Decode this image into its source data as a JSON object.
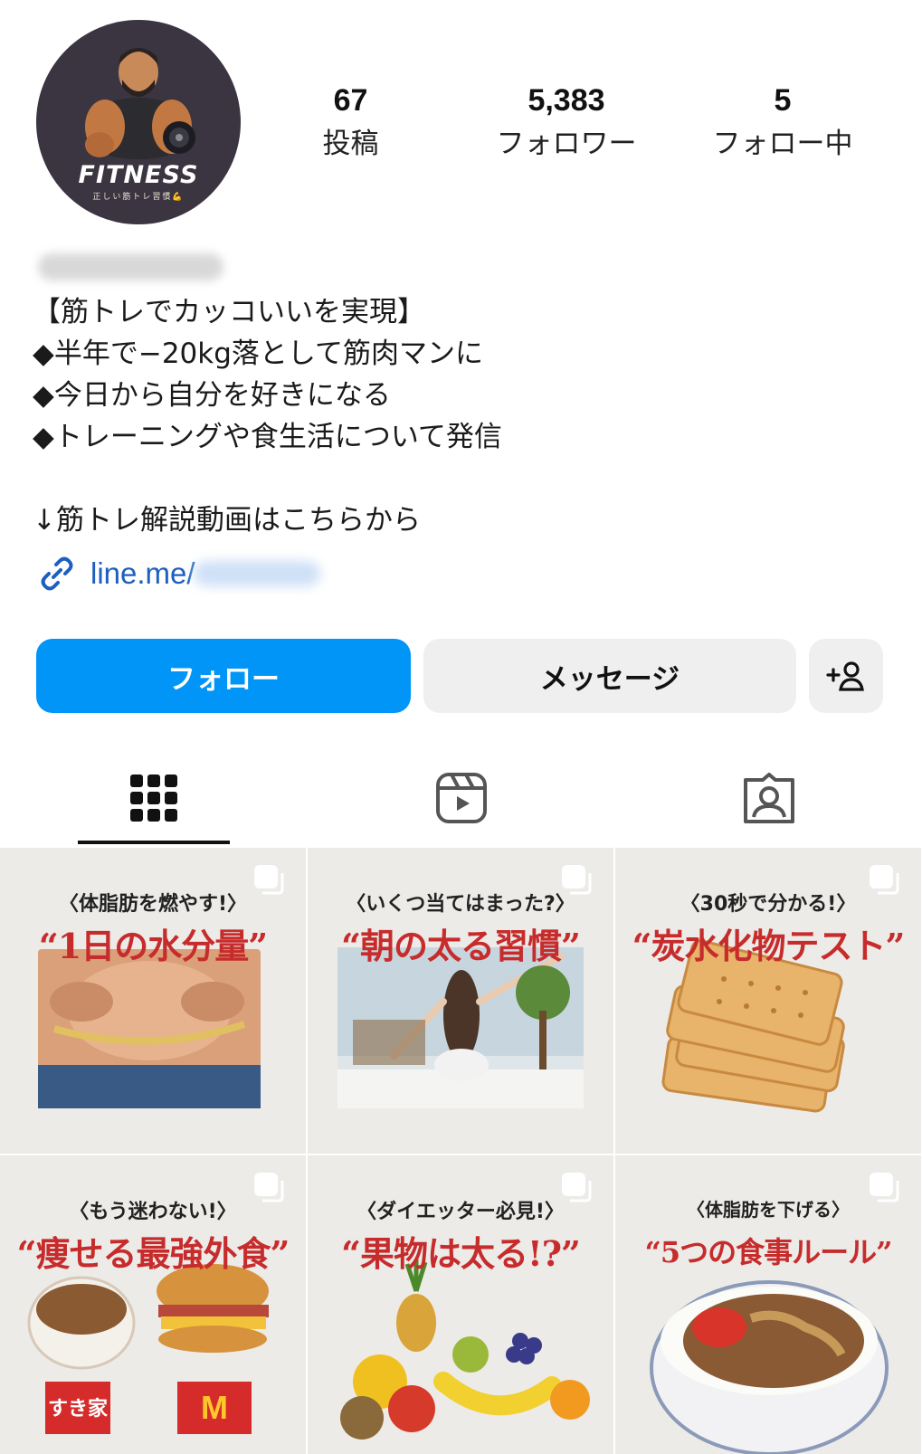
{
  "profile": {
    "avatar_text": "FITNESS",
    "avatar_subtext": "正しい筋トレ習慣💪"
  },
  "stats": {
    "posts": {
      "value": "67",
      "label": "投稿"
    },
    "followers": {
      "value": "5,383",
      "label": "フォロワー"
    },
    "following": {
      "value": "5",
      "label": "フォロー中"
    }
  },
  "bio": {
    "lines": [
      "【筋トレでカッコいいを実現】",
      "◆半年で−20kg落として筋肉マンに",
      "◆今日から自分を好きになる",
      "◆トレーニングや食生活について発信",
      "",
      "↓筋トレ解説動画はこちらから"
    ],
    "link": "line.me/"
  },
  "actions": {
    "follow": "フォロー",
    "message": "メッセージ"
  },
  "tabs": [
    {
      "icon": "grid-icon"
    },
    {
      "icon": "reels-icon"
    },
    {
      "icon": "tagged-icon"
    }
  ],
  "posts": [
    {
      "kicker": "〈体脂肪を燃やす!〉",
      "headline": "“1日の水分量”",
      "visual": "belly-fat-photo"
    },
    {
      "kicker": "〈いくつ当てはまった?〉",
      "headline": "“朝の太る習慣”",
      "visual": "morning-stretch-photo"
    },
    {
      "kicker": "〈30秒で分かる!〉",
      "headline": "“炭水化物テスト”",
      "visual": "crackers-photo"
    },
    {
      "kicker": "〈もう迷わない!〉",
      "headline": "“痩せる最強外食”",
      "visual": "gyudon-burger-photo",
      "logos": [
        "すき家",
        "M"
      ]
    },
    {
      "kicker": "〈ダイエッター必見!〉",
      "headline": "“果物は太る!?”",
      "visual": "fruits-photo"
    },
    {
      "kicker": "〈体脂肪を下げる〉",
      "headline": "“5つの食事ルール”",
      "visual": "beef-bowl-photo"
    }
  ],
  "colors": {
    "accent": "#0095f6",
    "link": "#1d5fbf",
    "headline_red": "#c72c2c",
    "avatar_bg": "#3b3441"
  }
}
